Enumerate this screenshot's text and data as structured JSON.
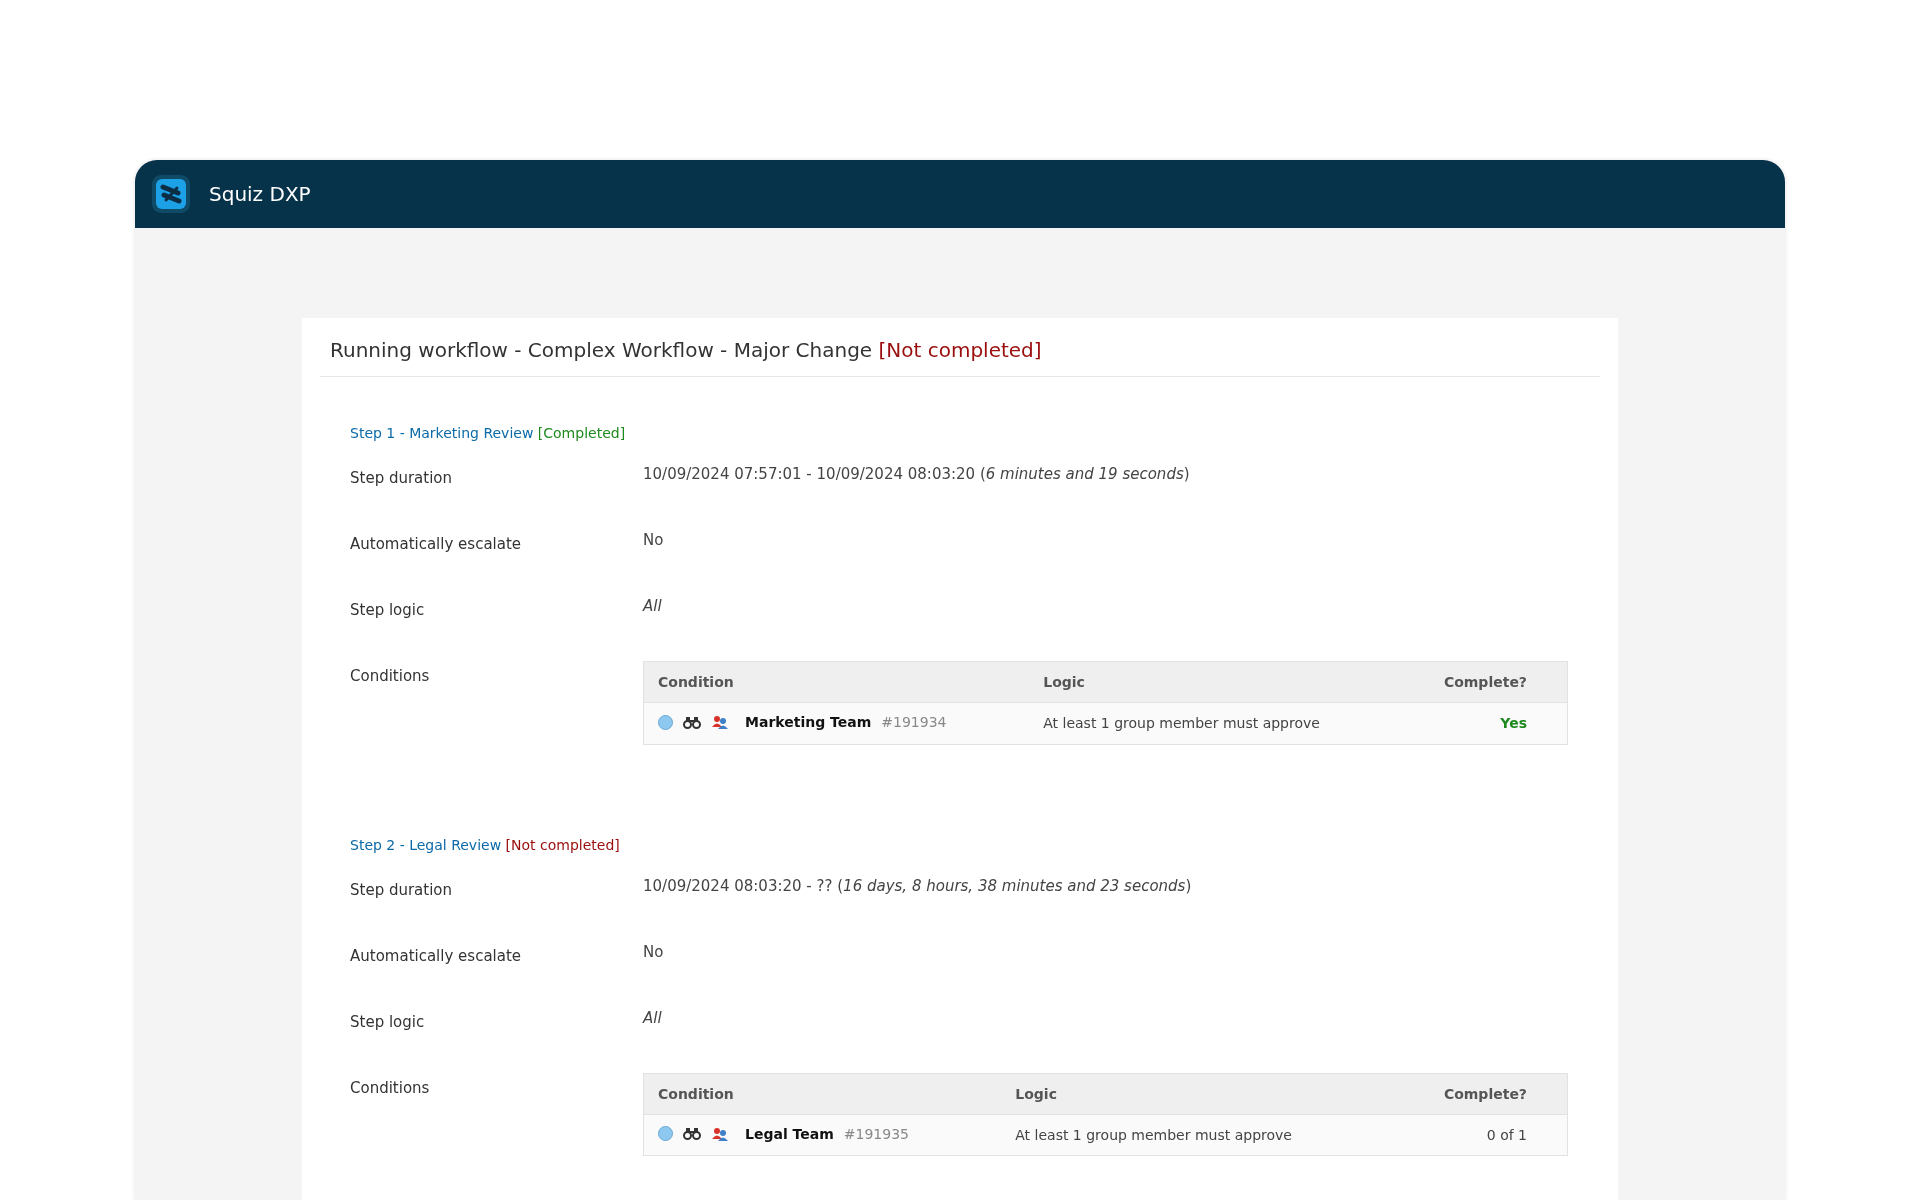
{
  "app": {
    "title": "Squiz DXP"
  },
  "workflow": {
    "title": "Running workflow - Complex Workflow - Major Change",
    "status": "[Not completed]",
    "completed": false
  },
  "steps": [
    {
      "title": "Step 1 - Marketing Review",
      "status": "[Completed]",
      "completed": true,
      "rows": [
        {
          "label": "Step duration",
          "kind": "text",
          "value": "10/09/2024 07:57:01 - 10/09/2024 08:03:20 (*6 minutes and 19 seconds*)"
        },
        {
          "label": "Automatically escalate",
          "kind": "text",
          "value": "No"
        },
        {
          "label": "Step logic",
          "kind": "italic",
          "value": "All"
        },
        {
          "label": "Conditions",
          "kind": "conditions",
          "columns": [
            "Condition",
            "Logic",
            "Complete?"
          ],
          "conditions": [
            {
              "name": "Marketing Team",
              "id": "#191934",
              "logic": "At least 1 group member must approve",
              "complete": "Yes",
              "done": true
            }
          ]
        }
      ]
    },
    {
      "title": "Step 2 - Legal Review",
      "status": "[Not completed]",
      "completed": false,
      "rows": [
        {
          "label": "Step duration",
          "kind": "text",
          "value": "10/09/2024 08:03:20 - ?? (*16 days, 8 hours, 38 minutes and 23 seconds*)"
        },
        {
          "label": "Automatically escalate",
          "kind": "text",
          "value": "No"
        },
        {
          "label": "Step logic",
          "kind": "italic",
          "value": "All"
        },
        {
          "label": "Conditions",
          "kind": "conditions",
          "columns": [
            "Condition",
            "Logic",
            "Complete?"
          ],
          "conditions": [
            {
              "name": "Legal Team",
              "id": "#191935",
              "logic": "At least 1 group member must approve",
              "complete": "0 of 1",
              "done": false
            }
          ]
        }
      ]
    }
  ]
}
